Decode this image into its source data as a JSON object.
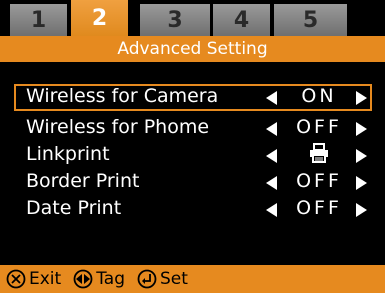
{
  "tabs": [
    {
      "label": "1",
      "active": false
    },
    {
      "label": "2",
      "active": true
    },
    {
      "label": "3",
      "active": false
    },
    {
      "label": "4",
      "active": false
    },
    {
      "label": "5",
      "active": false
    }
  ],
  "subtitle": "Advanced Setting",
  "menu": [
    {
      "label": "Wireless for Camera",
      "value": "ON",
      "selected": true
    },
    {
      "label": "Wireless for Phome",
      "value": "OFF",
      "selected": false
    },
    {
      "label": "Linkprint",
      "value": "",
      "icon": "printer-icon",
      "selected": false
    },
    {
      "label": "Border Print",
      "value": "OFF",
      "selected": false
    },
    {
      "label": "Date Print",
      "value": "OFF",
      "selected": false
    }
  ],
  "footer": {
    "exit_label": "Exit",
    "tag_label": "Tag",
    "set_label": "Set"
  },
  "colors": {
    "accent": "#e68a1f",
    "background": "#000000",
    "tab_inactive": "#8a8a8a"
  }
}
